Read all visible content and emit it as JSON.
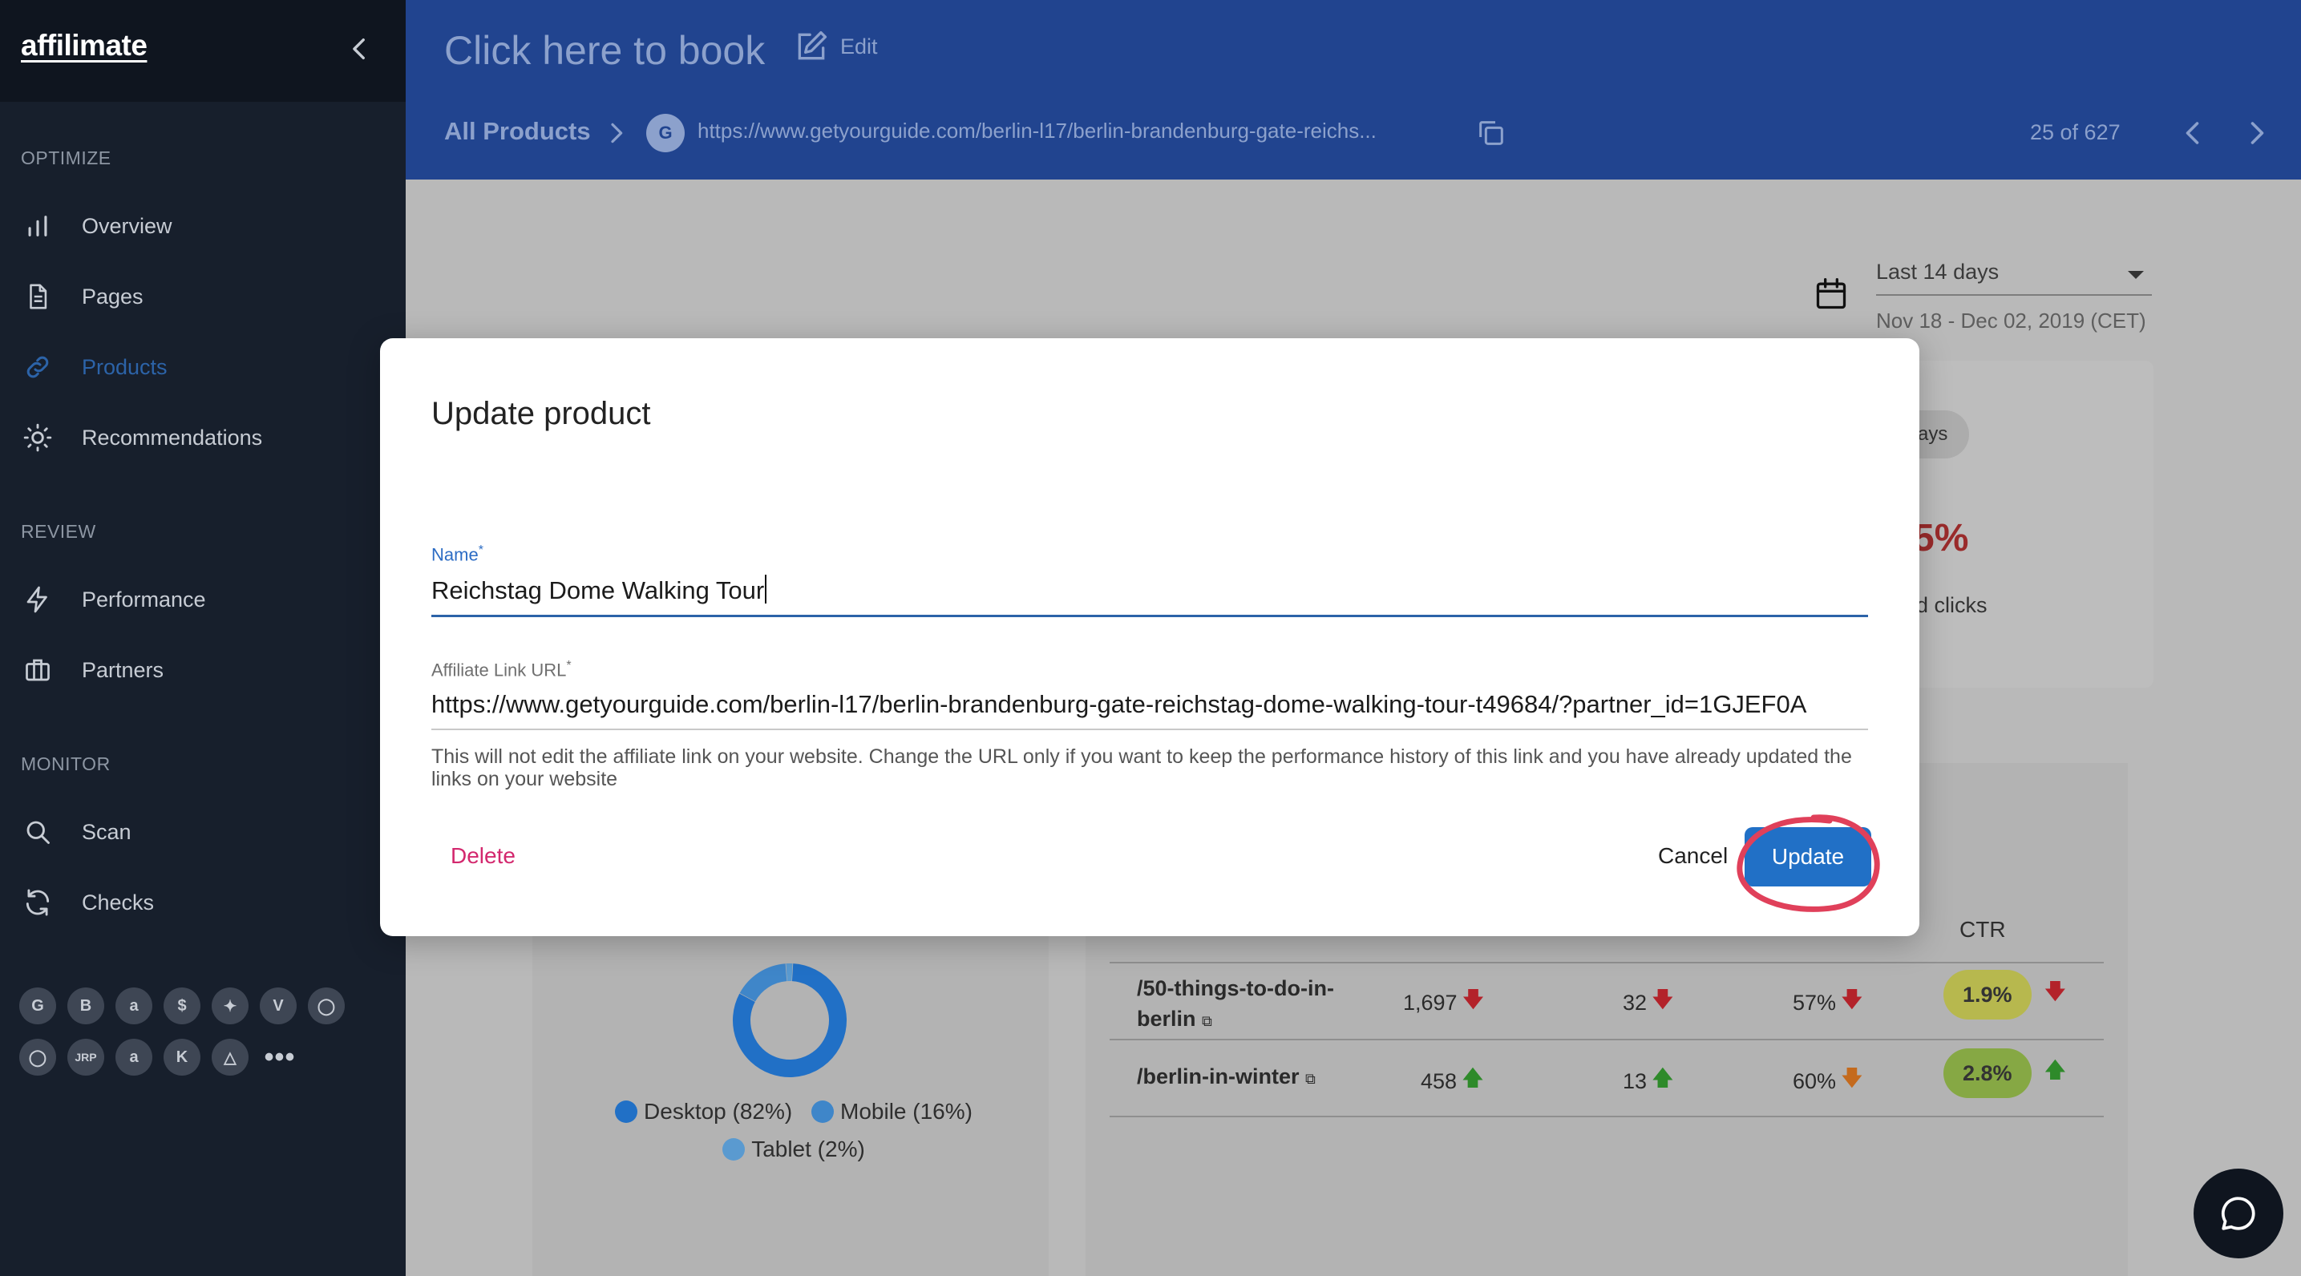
{
  "sidebar": {
    "logo": "affilimate",
    "sections": {
      "optimize": "OPTIMIZE",
      "review": "REVIEW",
      "monitor": "MONITOR"
    },
    "items": {
      "overview": "Overview",
      "pages": "Pages",
      "products": "Products",
      "recommendations": "Recommendations",
      "performance": "Performance",
      "partners": "Partners",
      "scan": "Scan",
      "checks": "Checks"
    },
    "partner_icons": [
      "G",
      "B",
      "a",
      "$",
      "",
      "V",
      "",
      "",
      "JRP",
      "a",
      "K",
      "",
      "•••"
    ]
  },
  "header": {
    "title": "Click here to book",
    "edit_label": "Edit",
    "breadcrumb": "All Products",
    "favicon_letter": "G",
    "url": "https://www.getyourguide.com/berlin-l17/berlin-brandenburg-gate-reichs...",
    "pagination": "25 of 627"
  },
  "date_range": {
    "selected": "Last 14 days",
    "dates": "Nov 18 - Dec 02, 2019 (CET)"
  },
  "summary_card": {
    "pill": "lays",
    "percent": "5%",
    "label": "d clicks"
  },
  "devices": {
    "legend": [
      {
        "label": "Desktop (82%)",
        "color": "#2170c6",
        "value": 82
      },
      {
        "label": "Mobile (16%)",
        "color": "#3f86c9",
        "value": 16
      },
      {
        "label": "Tablet (2%)",
        "color": "#5a9ad0",
        "value": 2
      }
    ]
  },
  "table": {
    "header_ctr": "CTR",
    "rows": [
      {
        "path": "/50-things-to-do-in-berlin",
        "seen": "1,697",
        "clicked": "32",
        "pct_seen": "57%",
        "ctr": "1.9%",
        "ctr_color": "#b7b84e"
      },
      {
        "path": "/berlin-in-winter",
        "seen": "458",
        "clicked": "13",
        "pct_seen": "60%",
        "ctr": "2.8%",
        "ctr_color": "#86a844"
      }
    ]
  },
  "modal": {
    "title": "Update product",
    "name_label": "Name",
    "name_value": "Reichstag Dome Walking Tour",
    "url_label": "Affiliate Link URL",
    "url_value": "https://www.getyourguide.com/berlin-l17/berlin-brandenburg-gate-reichstag-dome-walking-tour-t49684/?partner_id=1GJEF0A",
    "required_mark": "*",
    "help_text": "This will not edit the affiliate link on your website. Change the URL only if you want to keep the performance history of this link and you have already updated the links on your website",
    "delete_label": "Delete",
    "cancel_label": "Cancel",
    "update_label": "Update"
  },
  "colors": {
    "header_bg": "#21448f",
    "sidebar_bg": "#171f2c",
    "accent": "#2170c6",
    "danger": "#d3286e",
    "annotation": "#e0405a"
  }
}
